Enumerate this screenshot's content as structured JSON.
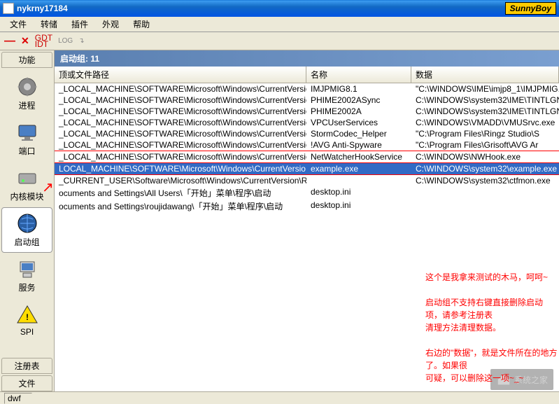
{
  "title": "nykrny17184",
  "brand": "SunnyBoy",
  "menus": [
    "文件",
    "转储",
    "插件",
    "外观",
    "帮助"
  ],
  "toolbar": {
    "gdt": "GDT",
    "idt": "IDT",
    "log": "LOG"
  },
  "sidebar": {
    "tab_top": "功能",
    "items": [
      {
        "label": "进程"
      },
      {
        "label": "端口"
      },
      {
        "label": "内核模块"
      },
      {
        "label": "启动组"
      },
      {
        "label": "服务"
      },
      {
        "label": "SPI"
      }
    ],
    "tab_reg": "注册表",
    "tab_file": "文件"
  },
  "content_header": "启动组: 11",
  "columns": {
    "c1": "顶或文件路径",
    "c2": "名称",
    "c3": "数据"
  },
  "rows": [
    {
      "path": "_LOCAL_MACHINE\\SOFTWARE\\Microsoft\\Windows\\CurrentVersio...",
      "name": "IMJPMIG8.1",
      "data": "\"C:\\WINDOWS\\IME\\imjp8_1\\IMJPMIG.",
      "sel": false,
      "redline": false
    },
    {
      "path": "_LOCAL_MACHINE\\SOFTWARE\\Microsoft\\Windows\\CurrentVersio...",
      "name": "PHIME2002ASync",
      "data": "C:\\WINDOWS\\system32\\IME\\TINTLGNT",
      "sel": false,
      "redline": false
    },
    {
      "path": "_LOCAL_MACHINE\\SOFTWARE\\Microsoft\\Windows\\CurrentVersio...",
      "name": "PHIME2002A",
      "data": "C:\\WINDOWS\\system32\\IME\\TINTLGNT",
      "sel": false,
      "redline": false
    },
    {
      "path": "_LOCAL_MACHINE\\SOFTWARE\\Microsoft\\Windows\\CurrentVersio...",
      "name": "VPCUserServices",
      "data": "C:\\WINDOWS\\VMADD\\VMUSrvc.exe",
      "sel": false,
      "redline": false
    },
    {
      "path": "_LOCAL_MACHINE\\SOFTWARE\\Microsoft\\Windows\\CurrentVersio...",
      "name": "StormCodec_Helper",
      "data": "\"C:\\Program Files\\Ringz Studio\\S",
      "sel": false,
      "redline": false
    },
    {
      "path": "_LOCAL_MACHINE\\SOFTWARE\\Microsoft\\Windows\\CurrentVersio...",
      "name": "!AVG Anti-Spyware",
      "data": "\"C:\\Program Files\\Grisoft\\AVG Ar",
      "sel": false,
      "redline": false
    },
    {
      "path": "_LOCAL_MACHINE\\SOFTWARE\\Microsoft\\Windows\\CurrentVersio...",
      "name": "NetWatcherHookService",
      "data": "C:\\WINDOWS\\NWHook.exe",
      "sel": false,
      "redline": true
    },
    {
      "path": "LOCAL_MACHINE\\SOFTWARE\\Microsoft\\Windows\\CurrentVersio...",
      "name": "example.exe",
      "data": "C:\\WINDOWS\\system32\\example.exe",
      "sel": true,
      "redline": true
    },
    {
      "path": "_CURRENT_USER\\Software\\Microsoft\\Windows\\CurrentVersion\\Run  ctfmon.exe",
      "name": "",
      "data": "C:\\WINDOWS\\system32\\ctfmon.exe",
      "sel": false,
      "redline": true
    },
    {
      "path": "ocuments and Settings\\All Users\\「开始」菜单\\程序\\启动",
      "name": "desktop.ini",
      "data": "",
      "sel": false,
      "redline": false
    },
    {
      "path": "ocuments and Settings\\roujidawang\\「开始」菜单\\程序\\启动",
      "name": "desktop.ini",
      "data": "",
      "sel": false,
      "redline": false
    }
  ],
  "annotations": [
    "这个是我拿来测试的木马，呵呵~",
    "",
    "启动组不支持右键直接删除启动项，请参考注册表",
    "清理方法清理数据。",
    "",
    "右边的\"数据\"，就是文件所在的地方了。如果很",
    "可疑，可以删除这一项~_~"
  ],
  "status": "dwf",
  "watermark": "系统之家"
}
